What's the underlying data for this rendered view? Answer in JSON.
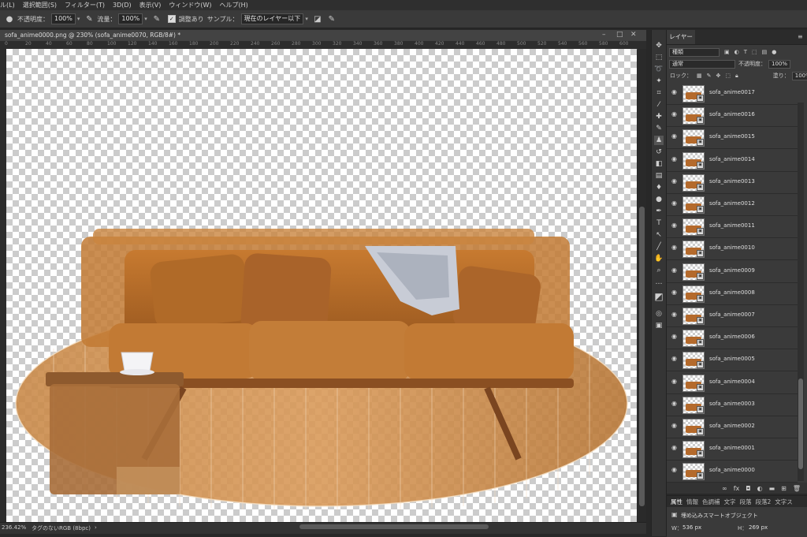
{
  "menu": [
    "ル(L)",
    "選択範囲(S)",
    "フィルター(T)",
    "3D(D)",
    "表示(V)",
    "ウィンドウ(W)",
    "ヘルプ(H)"
  ],
  "options": {
    "opacity_label": "不透明度：",
    "opacity_value": "100%",
    "flow_label": "流量：",
    "flow_value": "100%",
    "aligned_label": "調整あり",
    "sample_label": "サンプル：",
    "sample_value": "現在のレイヤー以下"
  },
  "document": {
    "tab_title": "sofa_anime0000.png @ 230% (sofa_anime0070, RGB/8#) *",
    "ruler_ticks": [
      "0",
      "20",
      "40",
      "60",
      "80",
      "100",
      "120",
      "140",
      "160",
      "180",
      "200",
      "220",
      "240",
      "260",
      "280",
      "300",
      "320",
      "340",
      "360",
      "380",
      "400",
      "420",
      "440",
      "460",
      "480",
      "500",
      "520",
      "540",
      "560",
      "580",
      "600"
    ],
    "zoom": "236.42%",
    "color_profile": "タグのないRGB (8bpc)"
  },
  "layers_panel": {
    "tab_label": "レイヤー",
    "filter_label": "種類",
    "blend_mode": "通常",
    "opacity_label": "不透明度：",
    "opacity_value": "100%",
    "lock_label": "ロック：",
    "fill_label": "塗り：",
    "fill_value": "100%",
    "layers": [
      "sofa_anime0017",
      "sofa_anime0016",
      "sofa_anime0015",
      "sofa_anime0014",
      "sofa_anime0013",
      "sofa_anime0012",
      "sofa_anime0011",
      "sofa_anime0010",
      "sofa_anime0009",
      "sofa_anime0008",
      "sofa_anime0007",
      "sofa_anime0006",
      "sofa_anime0005",
      "sofa_anime0004",
      "sofa_anime0003",
      "sofa_anime0002",
      "sofa_anime0001",
      "sofa_anime0000"
    ]
  },
  "properties_panel": {
    "tabs": [
      "属性",
      "情報",
      "色調補",
      "文字",
      "段落",
      "段落2",
      "文字ス"
    ],
    "kind": "埋め込みスマートオブジェクト",
    "w_label": "W：",
    "w_value": "536 px",
    "h_label": "H：",
    "h_value": "269 px"
  }
}
